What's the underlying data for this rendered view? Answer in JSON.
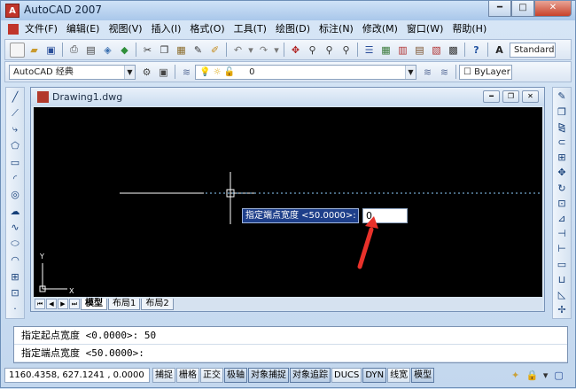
{
  "window": {
    "title": "AutoCAD 2007",
    "app_icon": "autocad-logo-icon",
    "controls": [
      "minimize",
      "maximize",
      "close"
    ]
  },
  "menu": {
    "items": [
      "文件(F)",
      "编辑(E)",
      "视图(V)",
      "插入(I)",
      "格式(O)",
      "工具(T)",
      "绘图(D)",
      "标注(N)",
      "修改(M)",
      "窗口(W)",
      "帮助(H)"
    ]
  },
  "toolbar1": {
    "style_combo": "Standard"
  },
  "toolbar2": {
    "workspace": "AutoCAD 经典",
    "layer_value": "0",
    "linetype": "ByLayer"
  },
  "drawing": {
    "title": "Drawing1.dwg",
    "tabs": [
      "模型",
      "布局1",
      "布局2"
    ],
    "active_tab": "模型",
    "ucs": {
      "y_label": "Y",
      "x_label": "X"
    },
    "dynamic_prompt": {
      "label": "指定端点宽度 <50.0000>:",
      "value": "0"
    }
  },
  "command": {
    "lines": [
      "指定起点宽度 <0.0000>: 50",
      "指定端点宽度 <50.0000>:"
    ]
  },
  "status": {
    "coords": "1160.4358, 627.1241 , 0.0000",
    "toggles": [
      {
        "label": "捕捉",
        "on": false
      },
      {
        "label": "栅格",
        "on": false
      },
      {
        "label": "正交",
        "on": false
      },
      {
        "label": "极轴",
        "on": true
      },
      {
        "label": "对象捕捉",
        "on": true
      },
      {
        "label": "对象追踪",
        "on": true
      },
      {
        "label": "DUCS",
        "on": false
      },
      {
        "label": "DYN",
        "on": true
      },
      {
        "label": "线宽",
        "on": false
      },
      {
        "label": "模型",
        "on": true
      }
    ]
  },
  "colors": {
    "canvas": "#000000",
    "prompt_bg": "#1e3f8a",
    "annotation_arrow": "#e8312a"
  }
}
